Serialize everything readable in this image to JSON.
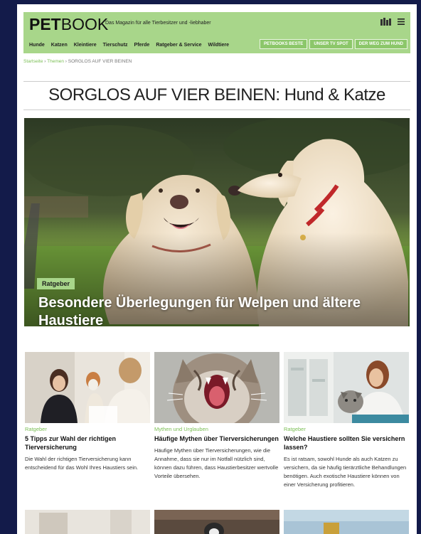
{
  "header": {
    "logo_bold": "PET",
    "logo_light": "BOOK",
    "tagline": "Das Magazin für alle Tierbesitzer und -liebhaber",
    "nav_left": [
      "Hunde",
      "Katzen",
      "Kleintiere",
      "Tierschutz",
      "Pferde",
      "Ratgeber & Service",
      "Wildtiere"
    ],
    "nav_right": [
      "PETBOOKS BESTE",
      "UNSER TV SPOT",
      "DER WEG ZUM HUND"
    ],
    "icons": [
      "library-icon",
      "menu-icon"
    ]
  },
  "breadcrumb": {
    "home": "Startseite",
    "sep1": " › ",
    "themes": "Themen",
    "sep2": " › ",
    "current": "SORGLOS AUF VIER BEINEN"
  },
  "page_title": "SORGLOS AUF VIER BEINEN: Hund & Katze",
  "hero": {
    "badge": "Ratgeber",
    "title": "Besondere Überlegungen für Welpen und ältere Haustiere"
  },
  "cards": [
    {
      "category": "Ratgeber",
      "title": "5 Tipps zur Wahl der richtigen Tierversicherung",
      "desc": "Die Wahl der richtigen Tierversicherung kann entscheidend für das Wohl Ihres Haustiers sein."
    },
    {
      "category": "Mythen und Urglauben",
      "title": "Häufige Mythen über Tierversicherungen",
      "desc": "Häufige Mythen über Tierversicherungen, wie die Annahme, dass sie nur im Notfall nützlich sind, können dazu führen, dass Haustierbesitzer wertvolle Vorteile übersehen."
    },
    {
      "category": "Ratgeber",
      "title": "Welche Haustiere sollten Sie versichern lassen?",
      "desc": "Es ist ratsam, sowohl Hunde als auch Katzen zu versichern, da sie häufig tierärztliche Behandlungen benötigen. Auch exotische Haustiere können von einer Versicherung profitieren."
    }
  ],
  "colors": {
    "accent": "#a8d68a",
    "category_green": "#7bbf55",
    "background": "#131b4a"
  }
}
